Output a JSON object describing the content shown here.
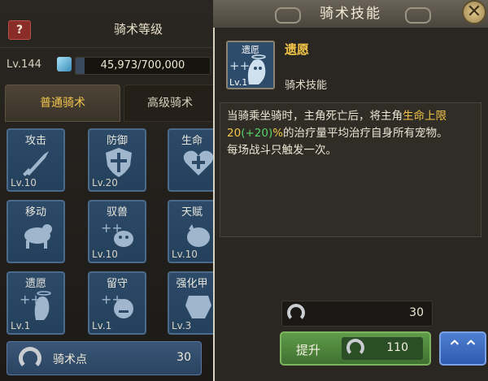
{
  "left": {
    "help_label": "?",
    "title": "骑术等级",
    "level_label": "Lv.144",
    "exp_text": "45,973/700,000",
    "exp_fraction": 0.0657,
    "tabs": [
      {
        "label": "普通骑术",
        "active": true
      },
      {
        "label": "高级骑术",
        "active": false
      }
    ],
    "skills": [
      {
        "name": "攻击",
        "level": "Lv.10",
        "icon": "sword-icon"
      },
      {
        "name": "防御",
        "level": "Lv.20",
        "icon": "shield-icon"
      },
      {
        "name": "生命",
        "level": "",
        "icon": "heart-icon"
      },
      {
        "name": "移动",
        "level": "",
        "icon": "running-beast-icon"
      },
      {
        "name": "驭兽",
        "level": "Lv.10",
        "icon": "tame-beast-icon"
      },
      {
        "name": "天赋",
        "level": "Lv.10",
        "icon": "talent-icon"
      },
      {
        "name": "遗愿",
        "level": "Lv.1",
        "icon": "ghost-icon"
      },
      {
        "name": "留守",
        "level": "Lv.1",
        "icon": "guard-beast-icon"
      },
      {
        "name": "强化甲",
        "level": "Lv.3",
        "icon": "armor-icon"
      }
    ],
    "points_label": "骑术点",
    "points_value": "30",
    "points_icon": "horseshoe-icon"
  },
  "popup": {
    "title": "骑术技能",
    "close_label": "✕",
    "icon_name": "遗愿",
    "icon_level": "Lv.1",
    "skill_name": "遗愿",
    "skill_type": "骑术技能",
    "desc_part1": "当骑乘坐骑时，主角死亡后，将主角",
    "desc_hl": "生命上限",
    "desc_val": "20",
    "desc_bonus": "(+20)",
    "desc_pct": "%",
    "desc_part2": "的治疗量平均治疗自身所有宠物。",
    "desc_part3": "每场战斗只触发一次。",
    "cost_value": "30",
    "upgrade_label": "提升",
    "upgrade_cost": "110",
    "max_label": "⌃⌃"
  },
  "colors": {
    "highlight": "#f3c548",
    "bonus": "#57d26a",
    "skill_tile": "#2c4a68",
    "upgrade_green": "#4f8a3d",
    "max_blue": "#3d6cc2"
  }
}
